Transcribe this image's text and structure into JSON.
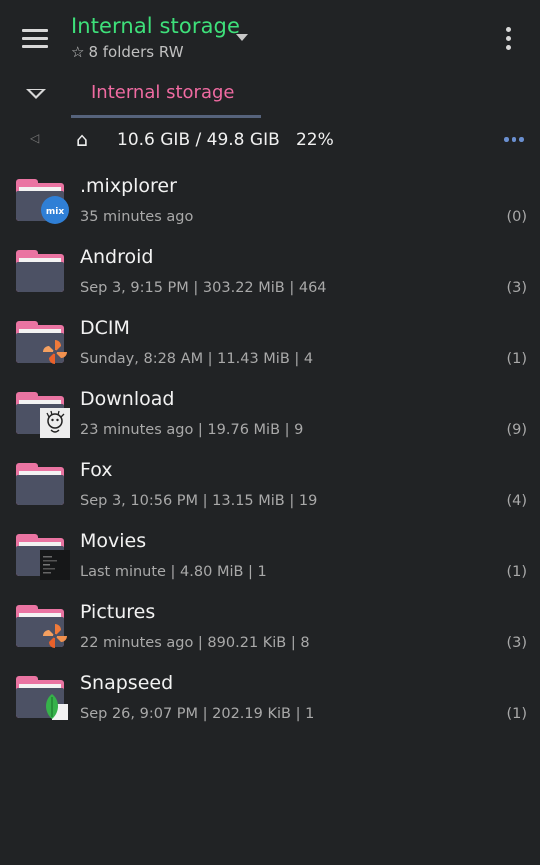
{
  "header": {
    "title": "Internal storage",
    "subtitle": "8 folders RW",
    "star_icon": "☆",
    "title_color": "#3ee07a"
  },
  "tabs": [
    {
      "label": "Internal storage",
      "active": true,
      "color": "#f06ba2"
    }
  ],
  "pathbar": {
    "back_icon": "◁",
    "home_icon": "⌂",
    "storage": "10.6 GIB / 49.8 GIB",
    "percent": "22%"
  },
  "folders": [
    {
      "name": ".mixplorer",
      "meta": "35 minutes ago",
      "count": "(0)",
      "badge": "mix-icon"
    },
    {
      "name": "Android",
      "meta": "Sep 3, 9:15 PM | 303.22 MiB | 464",
      "count": "(3)",
      "badge": ""
    },
    {
      "name": "DCIM",
      "meta": "Sunday, 8:28 AM | 11.43 MiB | 4",
      "count": "(1)",
      "badge": "pinwheel-icon"
    },
    {
      "name": "Download",
      "meta": "23 minutes ago | 19.76 MiB | 9",
      "count": "(9)",
      "badge": "sketch-thumbnail"
    },
    {
      "name": "Fox",
      "meta": "Sep 3, 10:56 PM | 13.15 MiB | 19",
      "count": "(4)",
      "badge": ""
    },
    {
      "name": "Movies",
      "meta": "Last minute | 4.80 MiB | 1",
      "count": "(1)",
      "badge": "video-thumbnail"
    },
    {
      "name": "Pictures",
      "meta": "22 minutes ago | 890.21  KiB | 8",
      "count": "(3)",
      "badge": "pinwheel-icon"
    },
    {
      "name": "Snapseed",
      "meta": "Sep 26, 9:07 PM | 202.19  KiB | 1",
      "count": "(1)",
      "badge": "snapseed-icon"
    }
  ]
}
